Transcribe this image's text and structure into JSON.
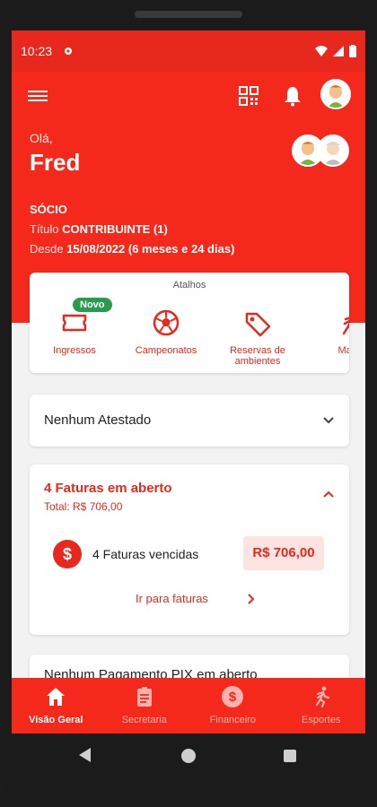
{
  "status_bar": {
    "time": "10:23"
  },
  "header": {
    "greeting": "Olá,",
    "user_name": "Fred",
    "role": "SÓCIO",
    "title_label": "Título",
    "title_value": "CONTRIBUINTE (1)",
    "since_label": "Desde",
    "since_value": "15/08/2022 (6 meses e 24 dias)"
  },
  "shortcuts": {
    "title": "Atalhos",
    "badge": "Novo",
    "items": [
      {
        "label": "Ingressos",
        "icon": "ticket-icon"
      },
      {
        "label": "Campeonatos",
        "icon": "soccer-ball-icon"
      },
      {
        "label": "Reservas de ambientes",
        "icon": "tag-icon"
      },
      {
        "label": "Matrí",
        "icon": "runner-icon"
      }
    ]
  },
  "certificates": {
    "title": "Nenhum Atestado"
  },
  "invoices": {
    "title": "4 Faturas em aberto",
    "total": "Total: R$ 706,00",
    "overdue_label": "4 Faturas vencidas",
    "overdue_amount": "R$ 706,00",
    "link": "Ir para faturas"
  },
  "pix": {
    "title": "Nenhum Pagamento PIX em aberto"
  },
  "bottom_nav": {
    "items": [
      {
        "label": "Visão Geral",
        "icon": "home-icon",
        "active": true
      },
      {
        "label": "Secretaria",
        "icon": "document-icon",
        "active": false
      },
      {
        "label": "Financeiro",
        "icon": "dollar-icon",
        "active": false
      },
      {
        "label": "Esportes",
        "icon": "runner-icon",
        "active": false
      }
    ]
  },
  "colors": {
    "primary": "#f5281c",
    "success": "#2a9a4f",
    "chip_bg": "#fde3e1"
  }
}
